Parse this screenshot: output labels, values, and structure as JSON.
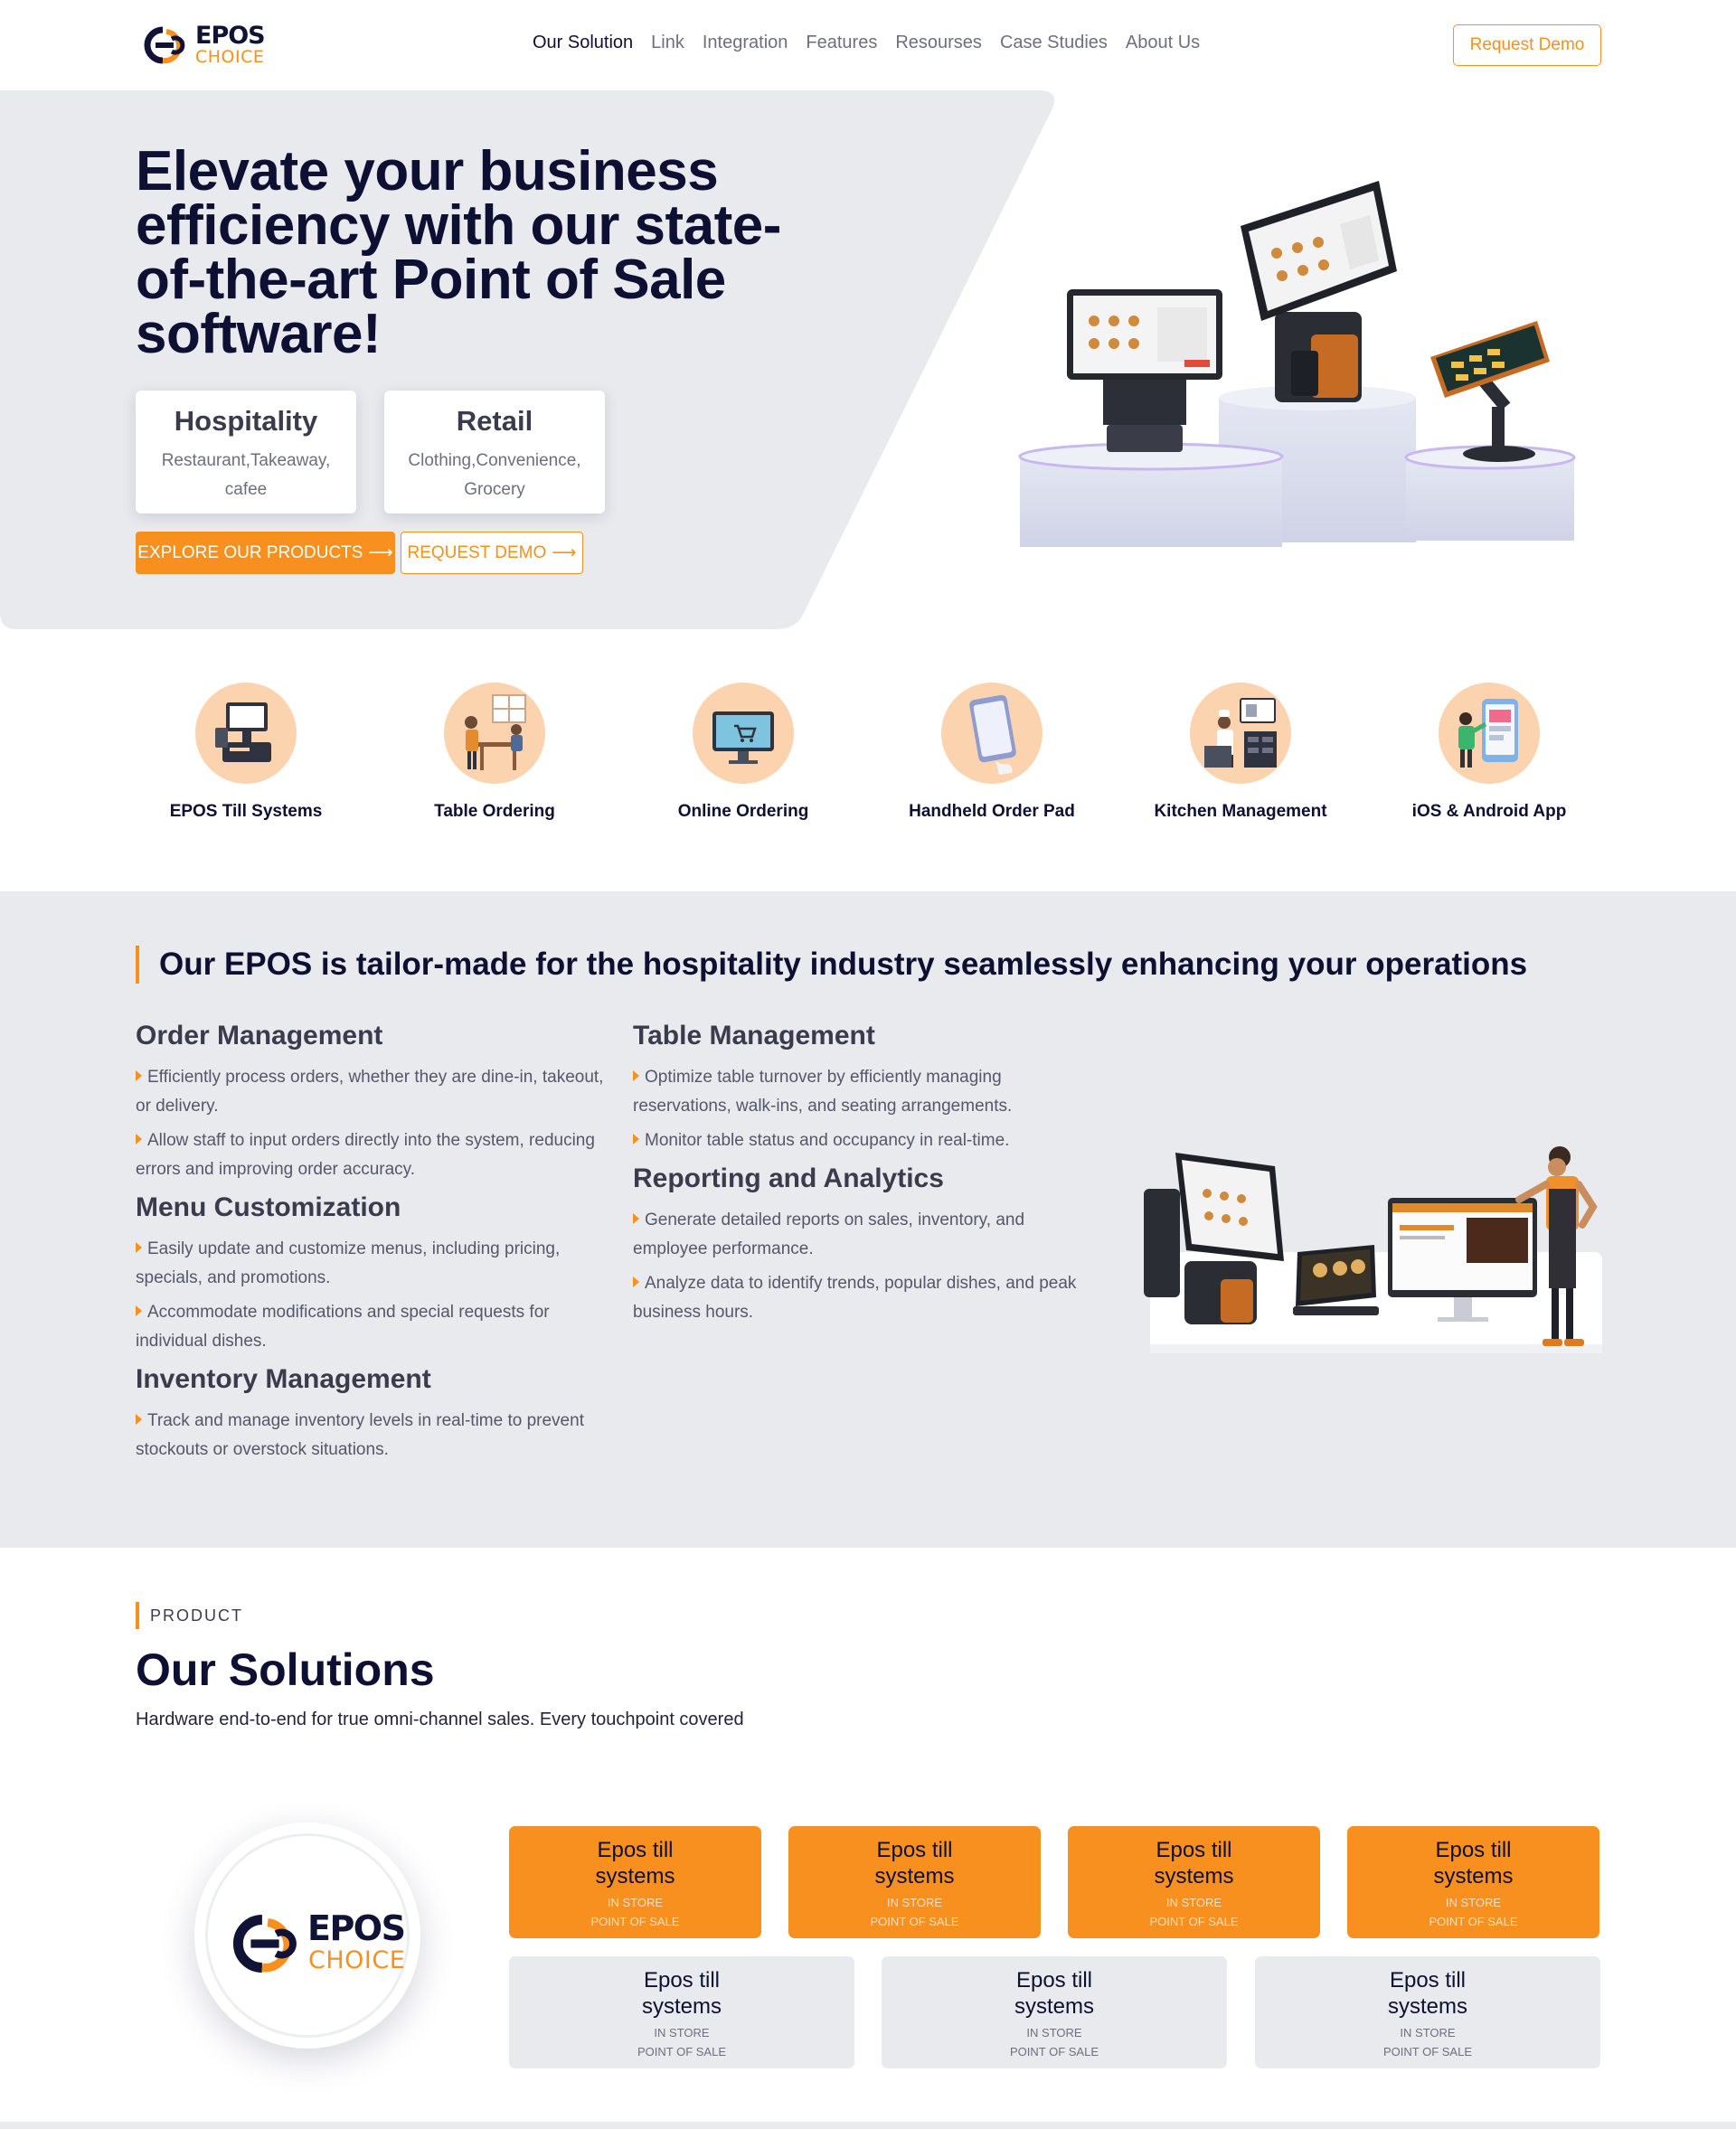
{
  "brand": {
    "word1": "EPOS",
    "word2": "CHOICE",
    "accent": "#f7901e",
    "navy": "#101236"
  },
  "nav": [
    {
      "label": "Our Solution"
    },
    {
      "label": "Link"
    },
    {
      "label": "Integration"
    },
    {
      "label": "Features"
    },
    {
      "label": "Resourses"
    },
    {
      "label": "Case Studies"
    },
    {
      "label": "About Us"
    }
  ],
  "header": {
    "demo_button": "Request Demo"
  },
  "hero": {
    "title": "Elevate your business efficiency with our state-of-the-art Point of Sale software!",
    "cards": [
      {
        "title": "Hospitality",
        "subtitle": "Restaurant,Takeaway, cafee"
      },
      {
        "title": "Retail",
        "subtitle": "Clothing,Convenience, Grocery"
      }
    ],
    "explore_button": "EXPLORE OUR PRODUCTS",
    "request_button": "REQUEST DEMO",
    "arrow": "⟶"
  },
  "features": [
    {
      "label": "EPOS Till Systems",
      "icon": "till-system-icon"
    },
    {
      "label": "Table Ordering",
      "icon": "table-ordering-icon"
    },
    {
      "label": "Online Ordering",
      "icon": "online-ordering-icon"
    },
    {
      "label": "Handheld Order Pad",
      "icon": "handheld-pad-icon"
    },
    {
      "label": "Kitchen Management",
      "icon": "kitchen-icon"
    },
    {
      "label": "iOS & Android App",
      "icon": "mobile-app-icon"
    }
  ],
  "hospitality": {
    "heading": "Our EPOS is tailor-made for the hospitality industry seamlessly enhancing your operations",
    "left": [
      {
        "title": "Order Management",
        "points": [
          "Efficiently process orders, whether they are dine-in, takeout, or delivery.",
          "Allow staff to input orders directly into the system, reducing errors and improving order accuracy."
        ]
      },
      {
        "title": "Menu Customization",
        "points": [
          "Easily update and customize menus, including pricing, specials, and promotions.",
          "Accommodate modifications and special requests for individual dishes."
        ]
      },
      {
        "title": "Inventory Management",
        "points": [
          "Track and manage inventory levels in real-time to prevent stockouts or overstock situations."
        ]
      }
    ],
    "right": [
      {
        "title": "Table Management",
        "points": [
          "Optimize table turnover by efficiently managing reservations, walk-ins, and seating arrangements.",
          "Monitor table status and occupancy in real-time."
        ]
      },
      {
        "title": "Reporting and Analytics",
        "points": [
          "Generate detailed reports on sales, inventory, and employee performance.",
          "Analyze data to identify trends, popular dishes, and peak business hours."
        ]
      }
    ]
  },
  "solutions": {
    "tag": "PRODUCT",
    "title": "Our Solutions",
    "subtitle": "Hardware end-to-end for true omni-channel sales. Every touchpoint covered",
    "tiles": [
      {
        "title": "Epos till systems",
        "sub1": "IN STORE",
        "sub2": "POINT OF SALE"
      },
      {
        "title": "Epos till systems",
        "sub1": "IN STORE",
        "sub2": "POINT OF SALE"
      },
      {
        "title": "Epos till systems",
        "sub1": "IN STORE",
        "sub2": "POINT OF SALE"
      },
      {
        "title": "Epos till systems",
        "sub1": "IN STORE",
        "sub2": "POINT OF SALE"
      },
      {
        "title": "Epos till systems",
        "sub1": "IN STORE",
        "sub2": "POINT OF SALE"
      },
      {
        "title": "Epos till systems",
        "sub1": "IN STORE",
        "sub2": "POINT OF SALE"
      },
      {
        "title": "Epos till systems",
        "sub1": "IN STORE",
        "sub2": "POINT OF SALE"
      }
    ]
  }
}
